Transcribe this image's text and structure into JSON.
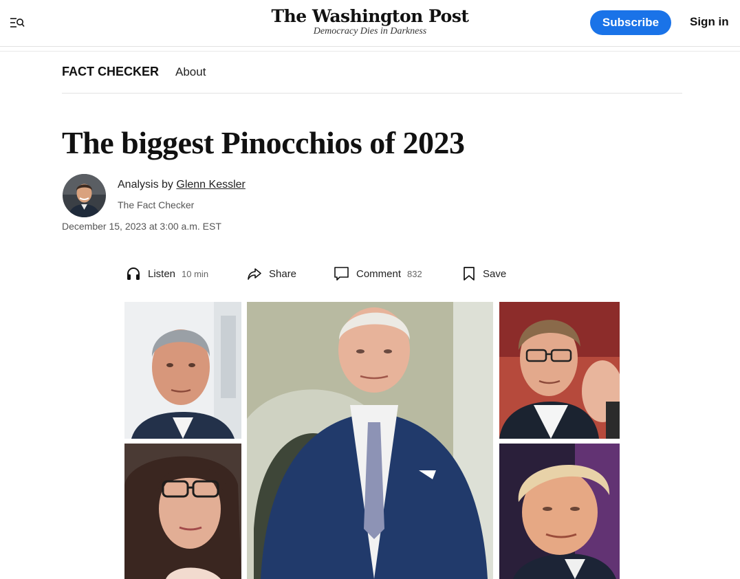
{
  "header": {
    "menu_icon": "menu-search-icon",
    "logo_title": "The Washington Post",
    "logo_tagline": "Democracy Dies in Darkness",
    "subscribe_label": "Subscribe",
    "signin_label": "Sign in",
    "accent_color": "#1a73e8"
  },
  "section_nav": {
    "title": "FACT CHECKER",
    "about": "About"
  },
  "article": {
    "headline": "The biggest Pinocchios of 2023",
    "byline_prefix": "Analysis by ",
    "author": "Glenn Kessler",
    "author_title": "The Fact Checker",
    "date": "December 15, 2023 at 3:00 a.m. EST"
  },
  "toolbar": {
    "listen_label": "Listen",
    "listen_duration": "10 min",
    "share_label": "Share",
    "comment_label": "Comment",
    "comment_count": "832",
    "save_label": "Save"
  },
  "photos": [
    "top-left-portrait",
    "center-portrait",
    "top-right-portrait",
    "bottom-left-portrait",
    "bottom-right-portrait"
  ]
}
